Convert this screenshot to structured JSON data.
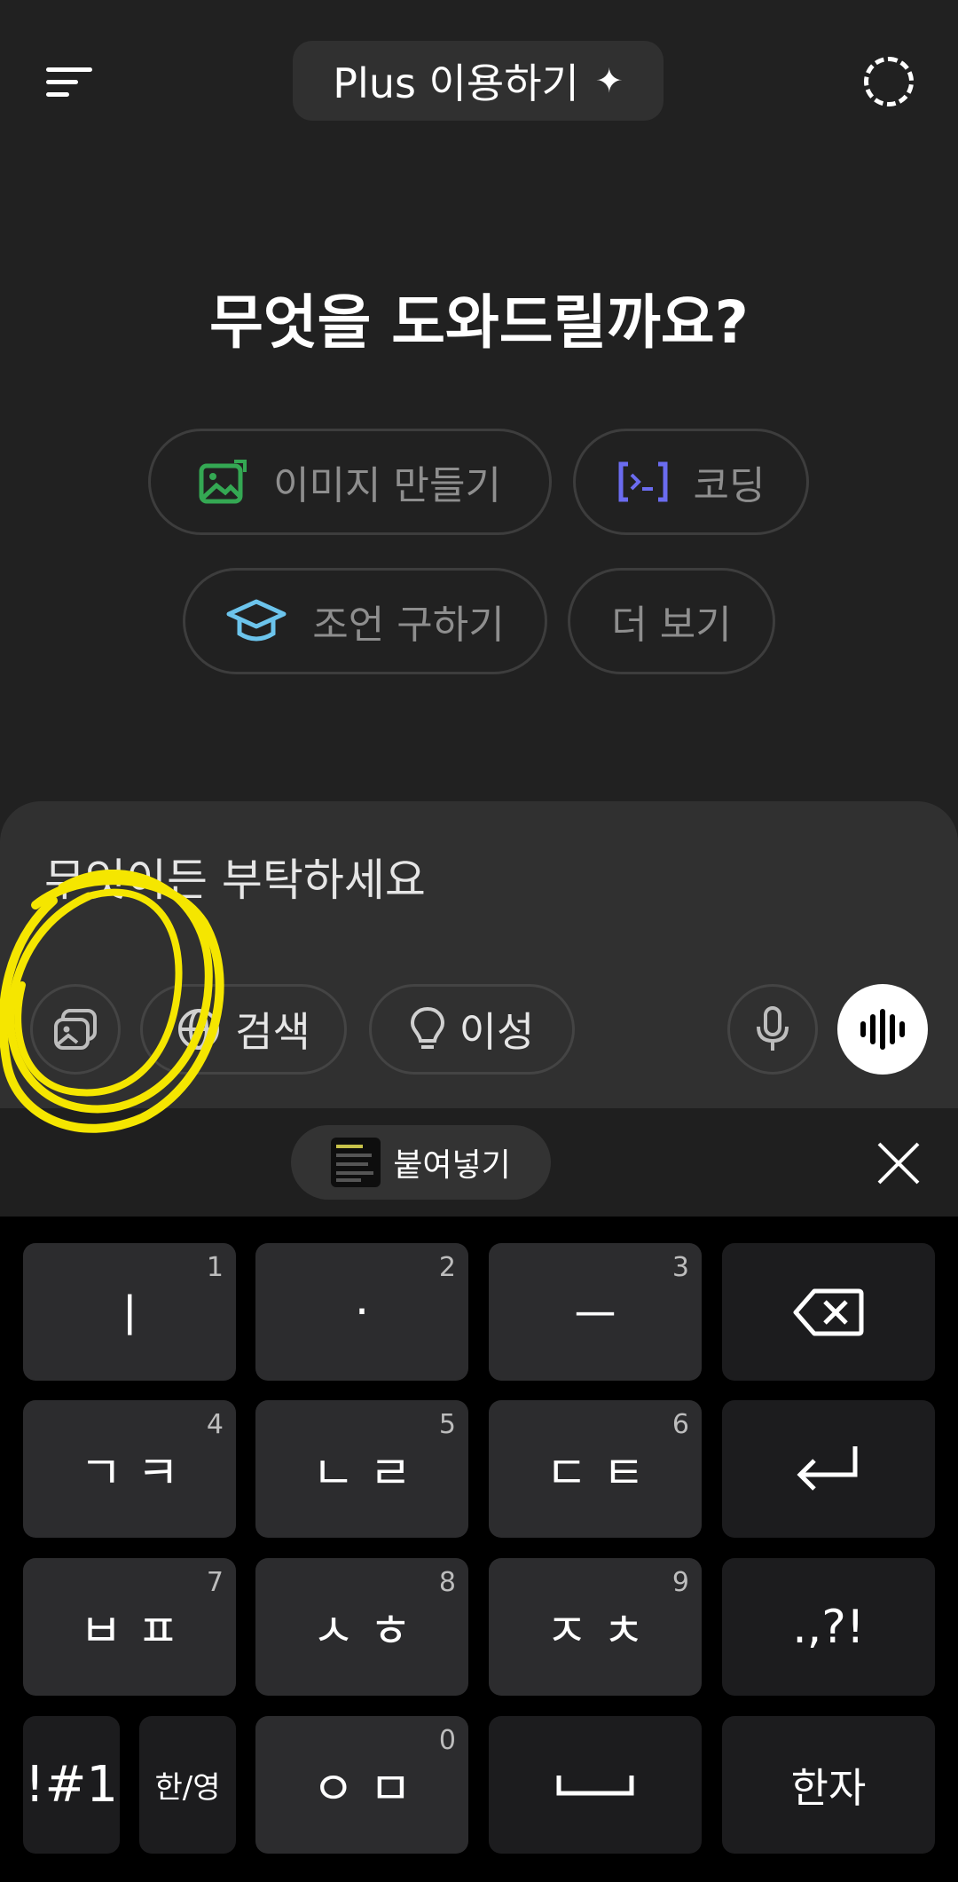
{
  "header": {
    "plus_label": "Plus 이용하기",
    "plus_spark": "✦"
  },
  "hero": {
    "title": "무엇을 도와드릴까요?"
  },
  "suggestions": [
    {
      "label": "이미지 만들기",
      "icon": "image-create-icon",
      "color": "#34a853"
    },
    {
      "label": "코딩",
      "icon": "code-icon",
      "color": "#6b6cf0"
    },
    {
      "label": "조언 구하기",
      "icon": "graduation-cap-icon",
      "color": "#6cc4ec"
    },
    {
      "label": "더 보기",
      "icon": "",
      "color": ""
    }
  ],
  "composer": {
    "placeholder": "무엇이든 부탁하세요",
    "tools": {
      "search_label": "검색",
      "reason_label": "이성"
    }
  },
  "clipboard": {
    "paste_label": "붙여넣기"
  },
  "keyboard": {
    "rows": [
      [
        {
          "label": "ㅣ",
          "num": "1"
        },
        {
          "label": "·",
          "num": "2"
        },
        {
          "label": "ㅡ",
          "num": "3"
        },
        {
          "label": "",
          "icon": "backspace-icon"
        }
      ],
      [
        {
          "label": "ㄱ ㅋ",
          "num": "4"
        },
        {
          "label": "ㄴ ㄹ",
          "num": "5"
        },
        {
          "label": "ㄷ ㅌ",
          "num": "6"
        },
        {
          "label": "",
          "icon": "enter-icon"
        }
      ],
      [
        {
          "label": "ㅂ ㅍ",
          "num": "7"
        },
        {
          "label": "ㅅ ㅎ",
          "num": "8"
        },
        {
          "label": "ㅈ ㅊ",
          "num": "9"
        },
        {
          "label": ".,?!"
        }
      ],
      [
        {
          "label": "!#1"
        },
        {
          "label": "한/영"
        },
        {
          "label": "ㅇ ㅁ",
          "num": "0"
        },
        {
          "label": "",
          "icon": "space-icon"
        },
        {
          "label": "한자"
        }
      ]
    ]
  },
  "colors": {
    "background": "#212121",
    "annotation": "#f5e600"
  }
}
